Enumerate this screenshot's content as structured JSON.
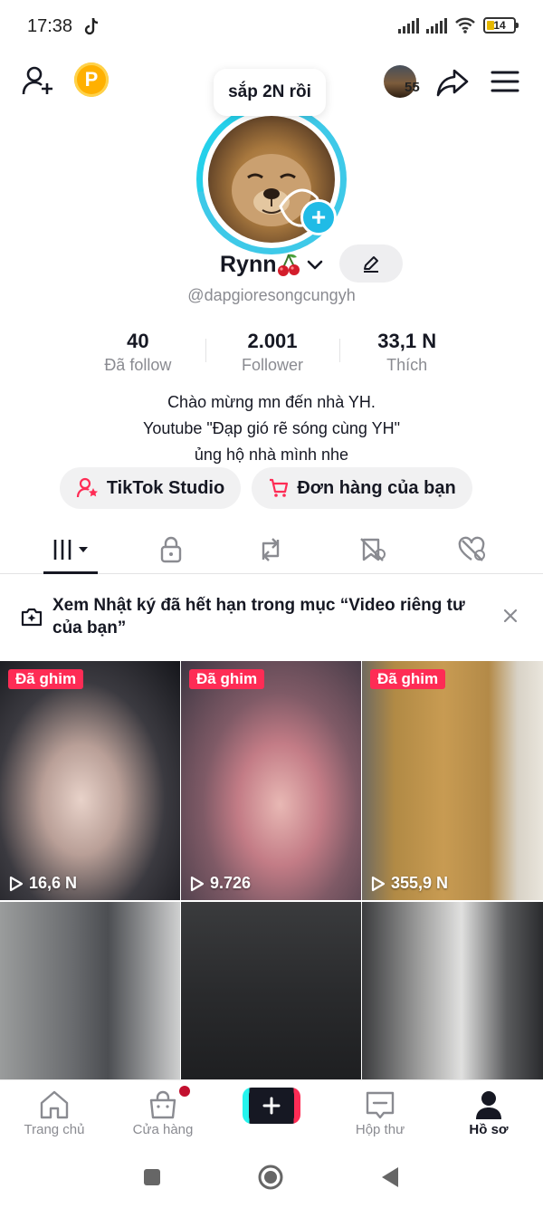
{
  "status_bar": {
    "time": "17:38",
    "battery": "14"
  },
  "top_bar": {
    "story_count": "55"
  },
  "profile": {
    "note": "sắp 2N rồi",
    "display_name": "Rynn",
    "username": "@dapgioresongcungyh",
    "stats": [
      {
        "value": "40",
        "label": "Đã follow"
      },
      {
        "value": "2.001",
        "label": "Follower"
      },
      {
        "value": "33,1 N",
        "label": "Thích"
      }
    ],
    "bio": [
      "Chào mừng mn đến  nhà YH.",
      "Youtube \"Đạp gió rẽ sóng cùng YH\"",
      "ủng hộ nhà mình nhe"
    ],
    "buttons": {
      "studio": "TikTok Studio",
      "orders": "Đơn hàng của bạn"
    }
  },
  "notice": {
    "text": "Xem Nhật ký đã hết hạn trong mục “Video riêng tư của bạn”"
  },
  "videos": [
    {
      "pinned": "Đã ghim",
      "views": "16,6 N"
    },
    {
      "pinned": "Đã ghim",
      "views": "9.726"
    },
    {
      "pinned": "Đã ghim",
      "views": "355,9 N"
    },
    {
      "pinned": "",
      "views": ""
    },
    {
      "pinned": "",
      "views": ""
    },
    {
      "pinned": "",
      "views": ""
    }
  ],
  "bottom_nav": {
    "home": "Trang chủ",
    "shop": "Cửa hàng",
    "inbox": "Hộp thư",
    "profile": "Hồ sơ"
  },
  "colors": {
    "accent": "#fe2c55",
    "cyan": "#25f4ee",
    "ring": "#3ec9e8"
  },
  "icons": [
    "add-friend-icon",
    "coin-icon",
    "share-icon",
    "menu-icon",
    "edit-icon",
    "grid-icon",
    "lock-icon",
    "repost-icon",
    "saved-icon",
    "liked-icon",
    "close-icon",
    "play-icon",
    "home-icon",
    "shop-icon",
    "plus-icon",
    "inbox-icon",
    "profile-icon"
  ]
}
